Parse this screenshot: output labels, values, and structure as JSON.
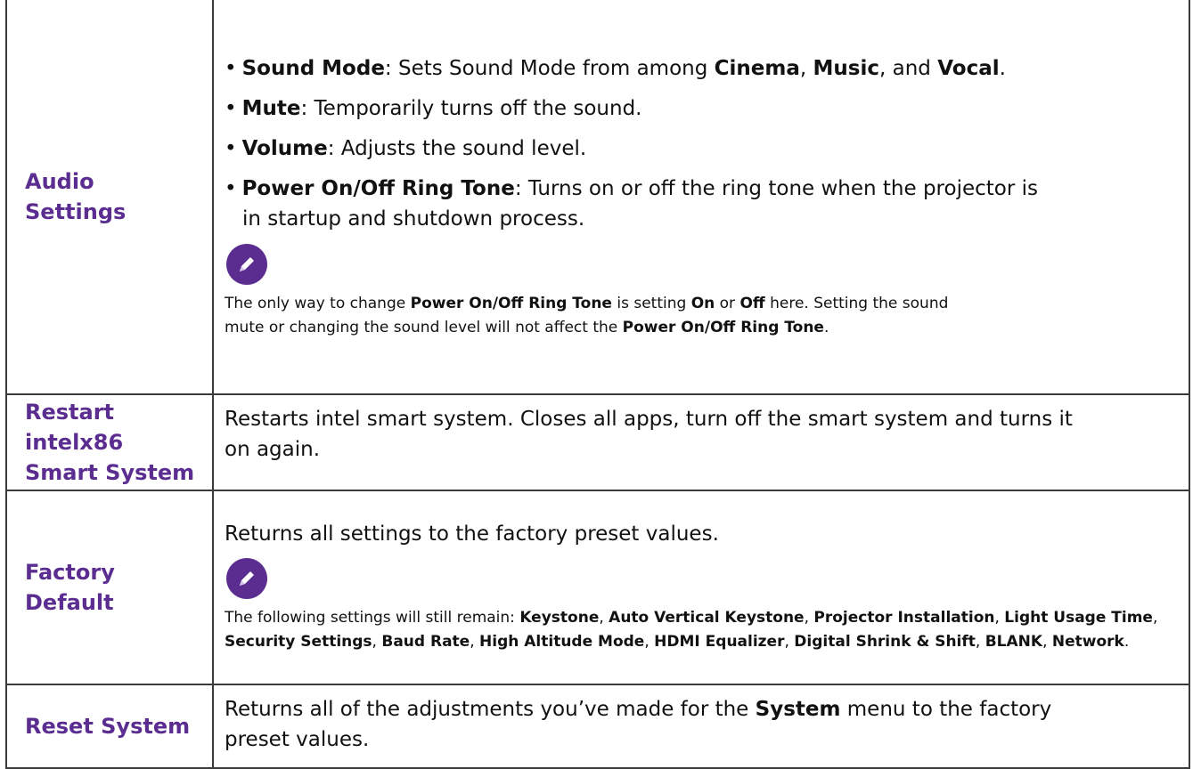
{
  "rows": [
    {
      "label_line1": "Audio",
      "label_line2": "Settings",
      "bullets": [
        {
          "term": "Sound Mode",
          "text_a": ": Sets Sound Mode from among ",
          "opt1": "Cinema",
          "sep1": ", ",
          "opt2": "Music",
          "sep2": ", and ",
          "opt3": "Vocal",
          "end": "."
        },
        {
          "term": "Mute",
          "text": ": Temporarily turns off the sound."
        },
        {
          "term": "Volume",
          "text": ": Adjusts the sound level."
        },
        {
          "term": "Power On/Off Ring Tone",
          "text": ": Turns on or off the ring tone when the projector is",
          "cont": "in startup and shutdown process."
        }
      ],
      "note": {
        "p1": "The only way to change ",
        "b1": "Power On/Off Ring Tone",
        "p2": " is setting ",
        "b2": "On",
        "p3": " or ",
        "b3": "Off",
        "p4": " here. Setting the sound",
        "p5": "mute or changing the sound level will not affect the ",
        "b4": "Power On/Off Ring Tone",
        "p6": "."
      }
    },
    {
      "label_line1": "Restart",
      "label_line2": "intelx86",
      "label_line3": "Smart System",
      "desc_line1": "Restarts intel smart system. Closes all apps, turn off the smart system and turns it",
      "desc_line2": "on again."
    },
    {
      "label_line1": "Factory",
      "label_line2": "Default",
      "desc": "Returns all settings to the factory preset values.",
      "note": {
        "intro": "The following settings will still remain: ",
        "items": [
          "Keystone",
          "Auto Vertical Keystone",
          "Projector Installation",
          "Light Usage Time",
          "Security Settings",
          "Baud Rate",
          "High Altitude Mode",
          "HDMI Equalizer",
          "Digital Shrink & Shift",
          "BLANK",
          "Network"
        ],
        "sep": ", ",
        "end": "."
      }
    },
    {
      "label": "Reset System",
      "desc_a": "Returns all of the adjustments you’ve made for the ",
      "desc_b": "System",
      "desc_c": " menu to the factory",
      "desc_d": "preset values."
    }
  ],
  "icons": {
    "note": "pencil-note-icon"
  },
  "colors": {
    "accent": "#5b2d90",
    "border": "#3a3a3a",
    "text": "#111111"
  }
}
